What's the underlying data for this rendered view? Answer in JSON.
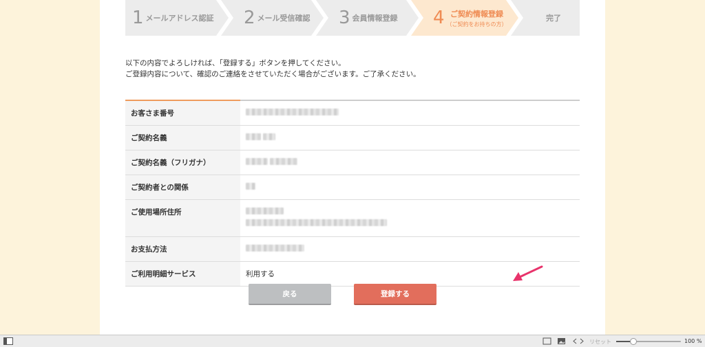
{
  "steps": [
    {
      "num": "1",
      "label": "メールアドレス認証"
    },
    {
      "num": "2",
      "label": "メール受信確認"
    },
    {
      "num": "3",
      "label": "会員情報登録"
    },
    {
      "num": "4",
      "label": "ご契約情報登録",
      "sub": "（ご契約をお持ちの方）"
    },
    {
      "num": "",
      "label": "完了"
    }
  ],
  "intro": {
    "line1": "以下の内容でよろしければ、「登録する」ボタンを押してください。",
    "line2": "ご登録内容について、確認のご連絡をさせていただく場合がございます。ご了承ください。"
  },
  "rows": [
    {
      "key": "お客さま番号",
      "value": ""
    },
    {
      "key": "ご契約名義",
      "value": ""
    },
    {
      "key": "ご契約名義（フリガナ）",
      "value": ""
    },
    {
      "key": "ご契約者との関係",
      "value": ""
    },
    {
      "key": "ご使用場所住所",
      "value": ""
    },
    {
      "key": "お支払方法",
      "value": ""
    },
    {
      "key": "ご利用明細サービス",
      "value": "利用する"
    }
  ],
  "buttons": {
    "back": "戻る",
    "submit": "登録する"
  },
  "statusbar": {
    "reset": "リセット",
    "zoom": "100 %",
    "zoom_level": 0.27
  },
  "colors": {
    "accent": "#ef8b53",
    "submit": "#e26e5c",
    "back": "#bdbfc1",
    "pointer": "#e8336b"
  }
}
